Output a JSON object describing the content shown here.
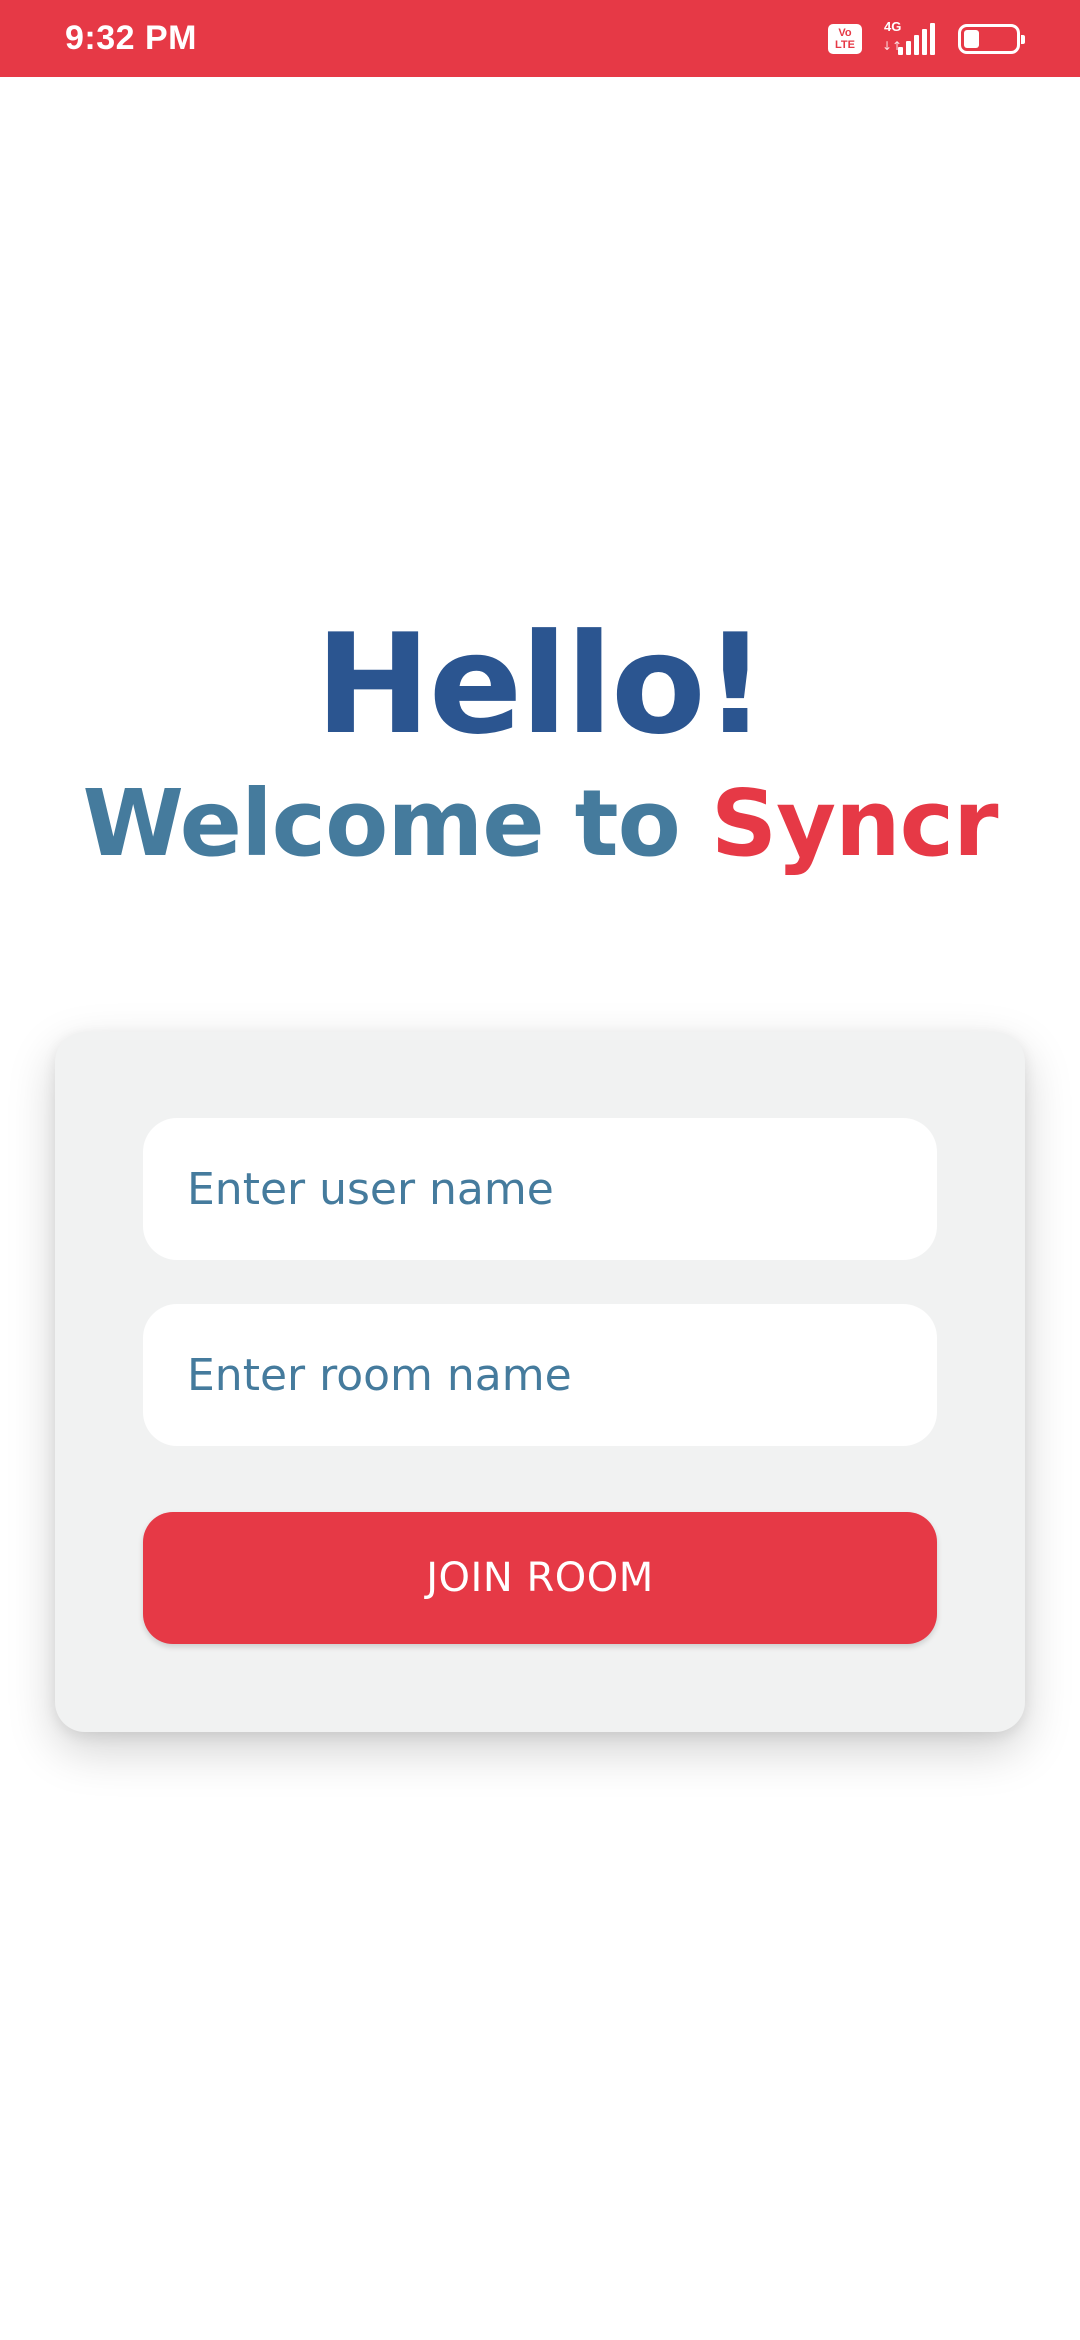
{
  "status_bar": {
    "time": "9:32 PM",
    "volte_top": "Vo",
    "volte_bottom": "LTE",
    "network": "4G",
    "network_arrows": "↓↑",
    "battery_level": 0.3
  },
  "header": {
    "greeting": "Hello!",
    "welcome_text": "Welcome to ",
    "brand": "Syncr"
  },
  "form": {
    "user_placeholder": "Enter user name",
    "user_value": "",
    "room_placeholder": "Enter room name",
    "room_value": "",
    "join_label": "JOIN ROOM"
  },
  "colors": {
    "accent": "#e63946",
    "title": "#2b5590",
    "text": "#457b9d",
    "card_background": "#f1f2f2"
  }
}
